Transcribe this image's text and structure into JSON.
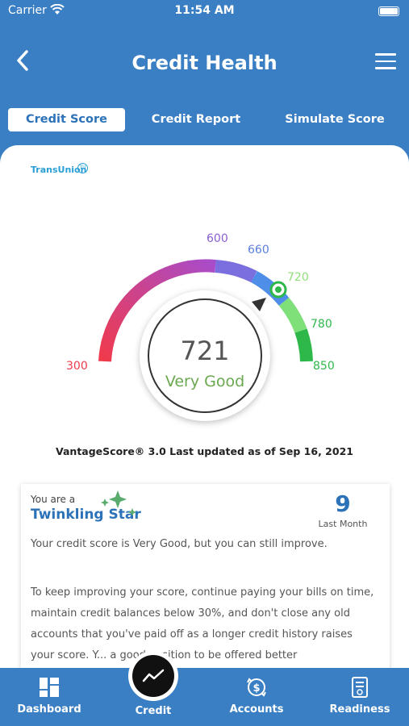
{
  "status": {
    "carrier": "Carrier",
    "time": "11:54 AM"
  },
  "header": {
    "title": "Credit Health"
  },
  "tabs": [
    {
      "label": "Credit Score",
      "active": true
    },
    {
      "label": "Credit Report",
      "active": false
    },
    {
      "label": "Simulate Score",
      "active": false
    }
  ],
  "bureau": "TransUnion",
  "bureau_badge": "TU",
  "gauge": {
    "ticks": [
      "300",
      "600",
      "660",
      "720",
      "780",
      "850"
    ],
    "score": "721",
    "rating": "Very Good"
  },
  "vantage": "VantageScore® 3.0 Last updated as of Sep 16, 2021",
  "badge_card": {
    "intro": "You are a",
    "title": "Twinkling Star",
    "months_value": "9",
    "months_label": "Last Month",
    "para1": "Your credit score is Very Good, but you can still improve.",
    "para2": "To keep improving your score, continue paying your bills on time, maintain credit balances below 30%, and don't close any old accounts that you've paid off as a longer credit history raises your score. Y... a good position to be offered better"
  },
  "bottom_nav": {
    "dashboard": "Dashboard",
    "credit": "Credit",
    "accounts": "Accounts",
    "readiness": "Readiness"
  },
  "colors": {
    "brand": "#3a7fc4",
    "accent": "#2c72b8",
    "good": "#6aa84f"
  }
}
